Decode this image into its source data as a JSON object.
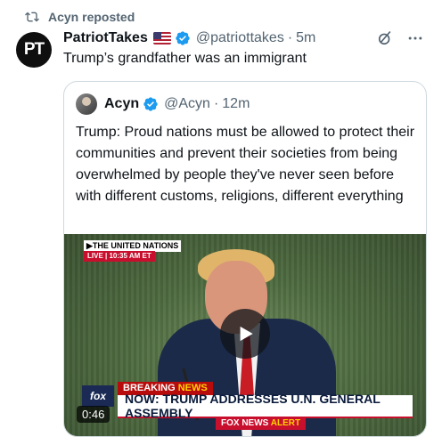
{
  "repost": {
    "text": "Acyn reposted"
  },
  "post": {
    "avatar_text": "PT",
    "name": "PatriotTakes",
    "handle": "@patriottakes",
    "separator": "·",
    "time": "5m",
    "text": "Trump’s grandfather was an immigrant"
  },
  "quote": {
    "name": "Acyn",
    "handle": "@Acyn",
    "separator": "·",
    "time": "12m",
    "text": "Trump: Proud nations must be allowed to protect their communities and prevent their societies from being overwhelmed by people they've never seen before with different customs, religions, different everything"
  },
  "video": {
    "channel_tag": "▶THE UNITED NATIONS",
    "live_tag": "LIVE | 10:35 AM ET",
    "breaking_word": "BREAKING",
    "breaking_news": "NEWS",
    "headline": "NOW: TRUMP ADDRESSES U.N. GENERAL ASSEMBLY",
    "alert_brand": "FOX NEWS",
    "alert_word": "ALERT",
    "logo_text": "fox",
    "duration": "0:46"
  },
  "icons": {
    "repost": "repost-icon",
    "verified": "verified-badge-icon",
    "grok": "grok-icon",
    "more": "more-icon",
    "play": "play-icon"
  },
  "colors": {
    "verified": "#1d9bf0",
    "muted": "#536471",
    "border": "#cfd9de"
  }
}
